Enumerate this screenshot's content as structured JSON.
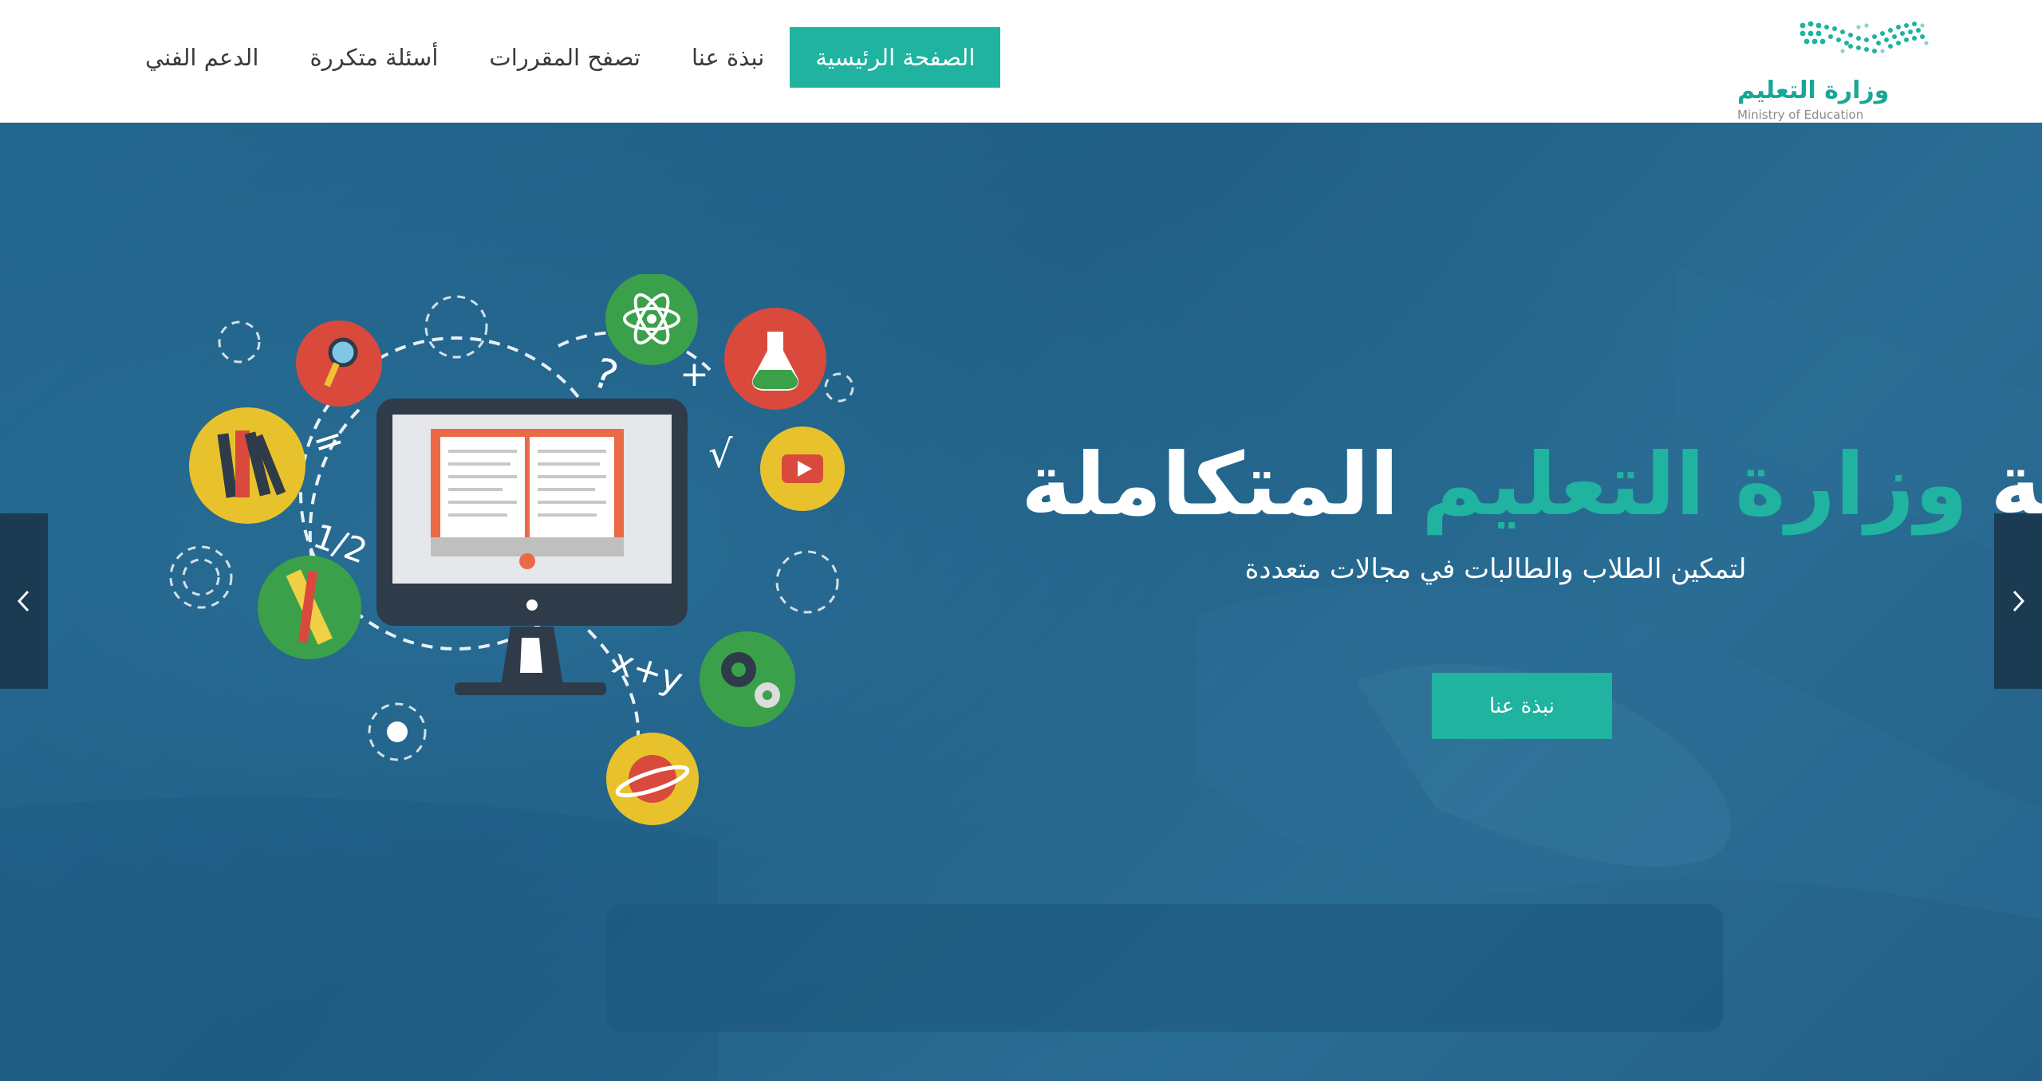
{
  "nav": {
    "items": [
      {
        "label": "الدعم الفني",
        "active": false
      },
      {
        "label": "أسئلة متكررة",
        "active": false
      },
      {
        "label": "تصفح المقررات",
        "active": false
      },
      {
        "label": "نبذة عنا",
        "active": false
      },
      {
        "label": "الصفحة الرئيسية",
        "active": true
      }
    ]
  },
  "logo": {
    "arabic": "وزارة التعليم",
    "english": "Ministry of Education"
  },
  "hero": {
    "title_part1": "منصة",
    "title_accent": "وزارة التعليم",
    "title_part2": "المتكاملة",
    "subtitle": "لتمكين الطلاب والطالبات في مجالات متعددة",
    "button_label": "نبذة عنا"
  },
  "illustration": {
    "labels": {
      "half": "1/2",
      "xy": "x+y",
      "question": "?",
      "plus": "+",
      "check": "√",
      "equals": "="
    }
  },
  "colors": {
    "accent": "#1fb3a0",
    "hero_bg": "#23678f",
    "nav_text": "#3a3a3a"
  }
}
